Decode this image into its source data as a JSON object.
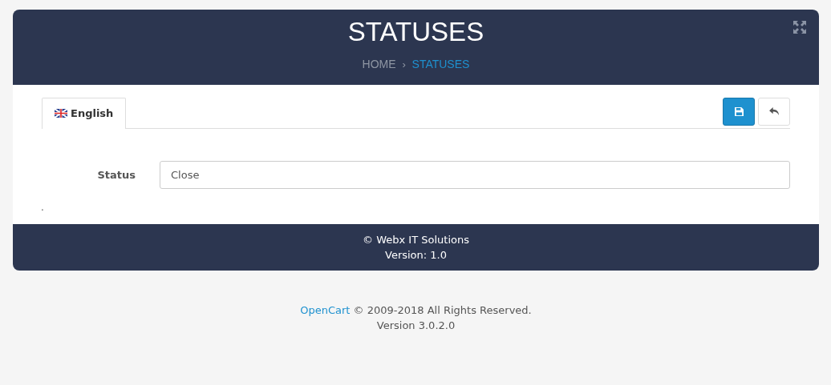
{
  "header": {
    "title": "STATUSES",
    "breadcrumb": [
      {
        "label": "HOME",
        "selected": false
      },
      {
        "label": "STATUSES",
        "selected": true
      }
    ],
    "separator": "›"
  },
  "tabs": [
    {
      "label": "English",
      "selected": true
    }
  ],
  "form": {
    "label": "Status",
    "value": "Close",
    "note": "."
  },
  "panel_footer": {
    "copyright": "© Webx IT Solutions",
    "version": "Version: 1.0"
  },
  "page_footer": {
    "link": "OpenCart",
    "text": " © 2009-2018 All Rights Reserved.",
    "version": "Version 3.0.2.0"
  }
}
